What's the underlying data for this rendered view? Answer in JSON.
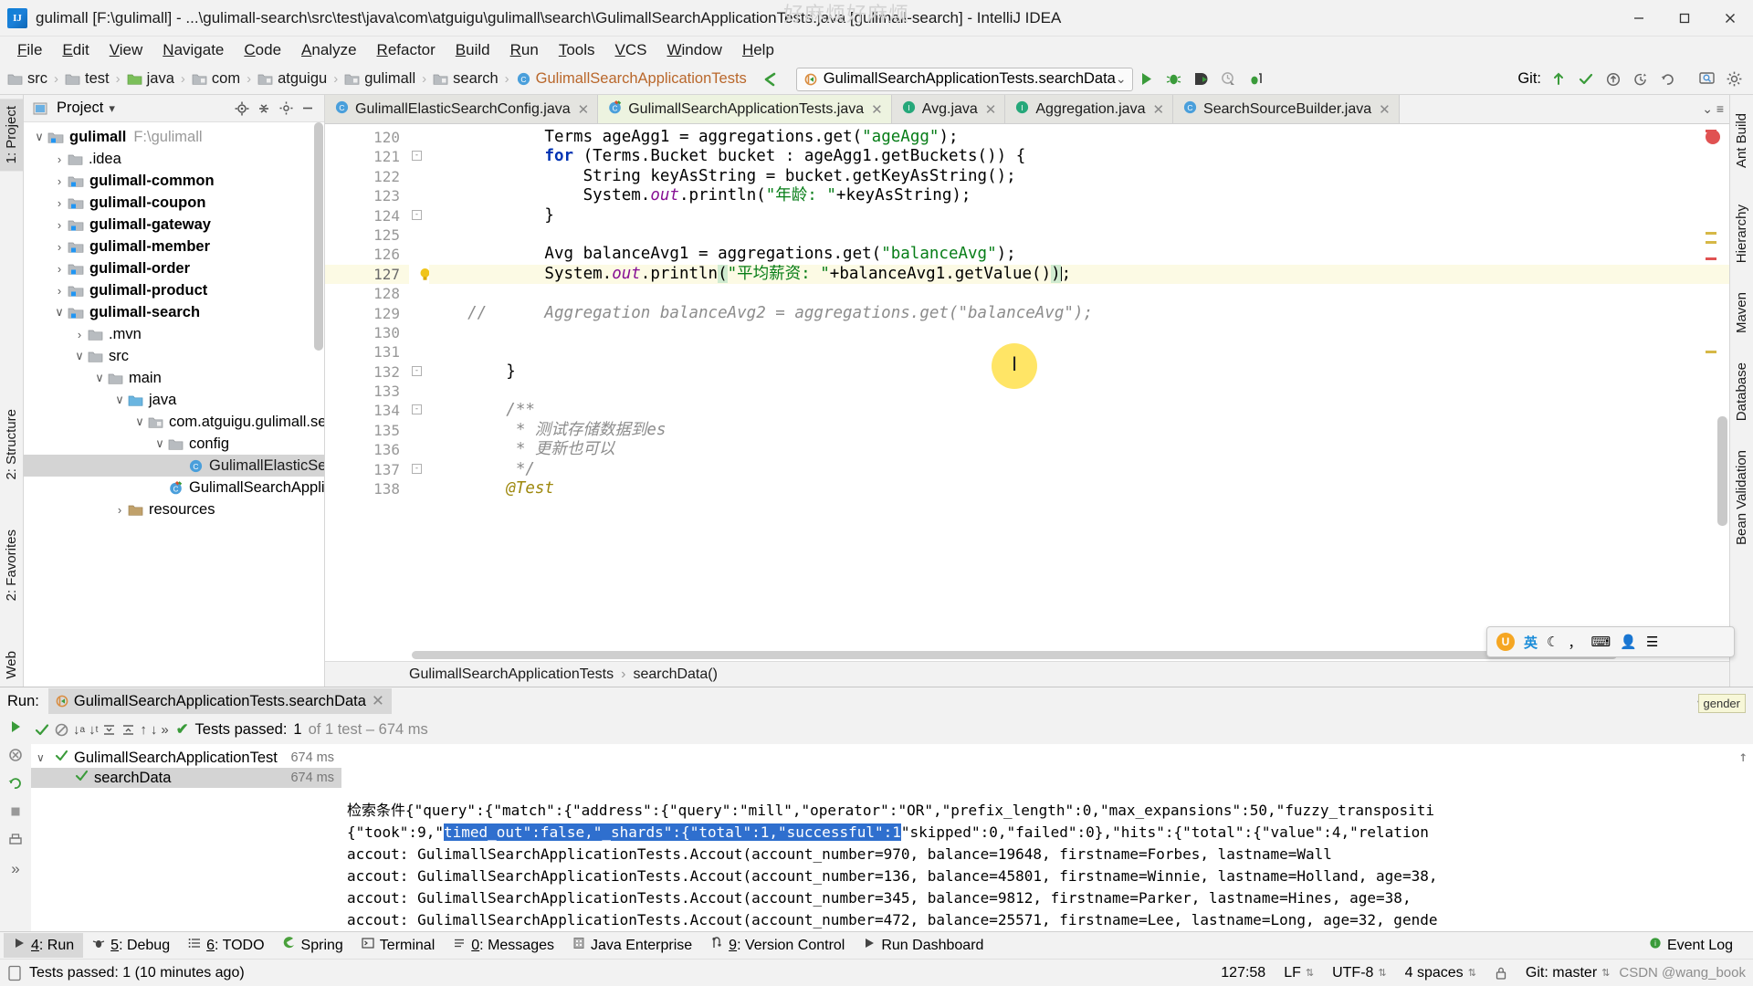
{
  "window": {
    "title": "gulimall [F:\\gulimall] - ...\\gulimall-search\\src\\test\\java\\com\\atguigu\\gulimall\\search\\GulimallSearchApplicationTests.java [gulimall-search] - IntelliJ IDEA",
    "app_icon": "IJ",
    "watermark_top": "好麻烦好麻烦",
    "minimize": "–",
    "maximize": "▢",
    "close": "✕"
  },
  "menu": [
    "File",
    "Edit",
    "View",
    "Navigate",
    "Code",
    "Analyze",
    "Refactor",
    "Build",
    "Run",
    "Tools",
    "VCS",
    "Window",
    "Help"
  ],
  "breadcrumb": [
    {
      "label": "src",
      "icon": "folder-icon"
    },
    {
      "label": "test",
      "icon": "folder-icon"
    },
    {
      "label": "java",
      "icon": "folder-green-icon"
    },
    {
      "label": "com",
      "icon": "package-icon"
    },
    {
      "label": "atguigu",
      "icon": "package-icon"
    },
    {
      "label": "gulimall",
      "icon": "package-icon"
    },
    {
      "label": "search",
      "icon": "package-icon"
    },
    {
      "label": "GulimallSearchApplicationTests",
      "icon": "class-icon"
    }
  ],
  "toolbar": {
    "run_config": "GulimallSearchApplicationTests.searchData",
    "dropdown_caret": "⌄",
    "buttons": [
      "run-button",
      "debug-button",
      "run-coverage-button",
      "profile-button",
      "stop-button"
    ],
    "git_label": "Git:",
    "git_buttons": [
      "update-project-icon",
      "commit-icon",
      "push-icon",
      "history-icon",
      "revert-icon"
    ],
    "right_buttons": [
      "search-everywhere-icon",
      "settings-icon"
    ]
  },
  "left_tool_tabs": [
    {
      "label": "1: Project",
      "selected": true
    }
  ],
  "right_tool_tabs": [
    "Ant Build",
    "Hierarchy",
    "Maven",
    "Database",
    "Bean Validation"
  ],
  "project_panel": {
    "title": "Project",
    "dropdown": "▾",
    "actions": [
      "locate-icon",
      "collapse-all-icon",
      "settings-icon",
      "hide-icon"
    ],
    "tree": [
      {
        "label": "gulimall",
        "path": "F:\\gulimall",
        "depth": 0,
        "arrow": "expanded",
        "icon": "module-icon",
        "bold": true
      },
      {
        "label": ".idea",
        "path": "",
        "depth": 1,
        "arrow": "collapsed",
        "icon": "folder-icon",
        "bold": false
      },
      {
        "label": "gulimall-common",
        "path": "",
        "depth": 1,
        "arrow": "collapsed",
        "icon": "module-icon",
        "bold": true
      },
      {
        "label": "gulimall-coupon",
        "path": "",
        "depth": 1,
        "arrow": "collapsed",
        "icon": "module-icon",
        "bold": true
      },
      {
        "label": "gulimall-gateway",
        "path": "",
        "depth": 1,
        "arrow": "collapsed",
        "icon": "module-icon",
        "bold": true
      },
      {
        "label": "gulimall-member",
        "path": "",
        "depth": 1,
        "arrow": "collapsed",
        "icon": "module-icon",
        "bold": true
      },
      {
        "label": "gulimall-order",
        "path": "",
        "depth": 1,
        "arrow": "collapsed",
        "icon": "module-icon",
        "bold": true
      },
      {
        "label": "gulimall-product",
        "path": "",
        "depth": 1,
        "arrow": "collapsed",
        "icon": "module-icon",
        "bold": true
      },
      {
        "label": "gulimall-search",
        "path": "",
        "depth": 1,
        "arrow": "expanded",
        "icon": "module-icon",
        "bold": true
      },
      {
        "label": ".mvn",
        "path": "",
        "depth": 2,
        "arrow": "collapsed",
        "icon": "folder-icon",
        "bold": false
      },
      {
        "label": "src",
        "path": "",
        "depth": 2,
        "arrow": "expanded",
        "icon": "folder-icon",
        "bold": false
      },
      {
        "label": "main",
        "path": "",
        "depth": 3,
        "arrow": "expanded",
        "icon": "folder-icon",
        "bold": false
      },
      {
        "label": "java",
        "path": "",
        "depth": 4,
        "arrow": "expanded",
        "icon": "folder-blue-icon",
        "bold": false
      },
      {
        "label": "com.atguigu.gulimall.sear",
        "path": "",
        "depth": 5,
        "arrow": "expanded",
        "icon": "package-icon",
        "bold": false
      },
      {
        "label": "config",
        "path": "",
        "depth": 6,
        "arrow": "expanded",
        "icon": "folder-icon",
        "bold": false
      },
      {
        "label": "GulimallElasticSear",
        "path": "",
        "depth": 7,
        "arrow": "none",
        "icon": "class-icon",
        "bold": false,
        "selected": true
      },
      {
        "label": "GulimallSearchApplica",
        "path": "",
        "depth": 6,
        "arrow": "none",
        "icon": "class-orange-icon",
        "bold": false
      },
      {
        "label": "resources",
        "path": "",
        "depth": 4,
        "arrow": "collapsed",
        "icon": "folder-resources-icon",
        "bold": false
      }
    ]
  },
  "editor_tabs": [
    {
      "label": "GulimallElasticSearchConfig.java",
      "icon": "class-icon",
      "active": false,
      "close": "✕"
    },
    {
      "label": "GulimallSearchApplicationTests.java",
      "icon": "test-class-icon",
      "active": true,
      "close": "✕"
    },
    {
      "label": "Avg.java",
      "icon": "interface-icon",
      "active": false,
      "close": "✕"
    },
    {
      "label": "Aggregation.java",
      "icon": "interface-icon",
      "active": false,
      "close": "✕"
    },
    {
      "label": "SearchSourceBuilder.java",
      "icon": "class-icon",
      "active": false,
      "close": "✕"
    }
  ],
  "editor": {
    "first_line": 120,
    "current_line": 127,
    "lines": [
      {
        "n": 120,
        "segments": [
          {
            "t": "            Terms ",
            "c": "typ"
          },
          {
            "t": "ageAgg1 ",
            "c": "typ"
          },
          {
            "t": "= aggregations.get(",
            "c": "typ"
          },
          {
            "t": "\"ageAgg\"",
            "c": "str"
          },
          {
            "t": ");",
            "c": "typ"
          }
        ]
      },
      {
        "n": 121,
        "fold": "-",
        "segments": [
          {
            "t": "            ",
            "c": "typ"
          },
          {
            "t": "for",
            "c": "kw"
          },
          {
            "t": " (Terms.Bucket bucket : ageAgg1.getBuckets()) {",
            "c": "typ"
          }
        ]
      },
      {
        "n": 122,
        "segments": [
          {
            "t": "                String keyAsString = bucket.getKeyAsString();",
            "c": "typ"
          }
        ]
      },
      {
        "n": 123,
        "segments": [
          {
            "t": "                System.",
            "c": "typ"
          },
          {
            "t": "out",
            "c": "fld"
          },
          {
            "t": ".println(",
            "c": "typ"
          },
          {
            "t": "\"年龄: \"",
            "c": "str"
          },
          {
            "t": "+keyAsString);",
            "c": "typ"
          }
        ]
      },
      {
        "n": 124,
        "fold": "-",
        "segments": [
          {
            "t": "            }",
            "c": "typ"
          }
        ]
      },
      {
        "n": 125,
        "segments": [
          {
            "t": "",
            "c": "typ"
          }
        ]
      },
      {
        "n": 126,
        "segments": [
          {
            "t": "            Avg balanceAvg1 = aggregations.get(",
            "c": "typ"
          },
          {
            "t": "\"balanceAvg\"",
            "c": "str"
          },
          {
            "t": ");",
            "c": "typ"
          }
        ]
      },
      {
        "n": 127,
        "current": true,
        "bulb": true,
        "segments": [
          {
            "t": "            System.",
            "c": "typ"
          },
          {
            "t": "out",
            "c": "fld"
          },
          {
            "t": ".println",
            "c": "typ"
          },
          {
            "t": "(",
            "c": "hl"
          },
          {
            "t": "\"平均薪资: \"",
            "c": "str"
          },
          {
            "t": "+balanceAvg1.getValue()",
            "c": "typ"
          },
          {
            "t": ")",
            "c": "hl"
          },
          {
            "t": ";",
            "c": "typ"
          }
        ]
      },
      {
        "n": 128,
        "segments": [
          {
            "t": "",
            "c": "typ"
          }
        ]
      },
      {
        "n": 129,
        "segments": [
          {
            "t": "    //      Aggregation balanceAvg2 = aggregations.get(\"balanceAvg\");",
            "c": "cmt"
          }
        ]
      },
      {
        "n": 130,
        "segments": [
          {
            "t": "",
            "c": "typ"
          }
        ]
      },
      {
        "n": 131,
        "segments": [
          {
            "t": "",
            "c": "typ"
          }
        ]
      },
      {
        "n": 132,
        "fold": "-",
        "segments": [
          {
            "t": "        }",
            "c": "typ"
          }
        ]
      },
      {
        "n": 133,
        "segments": [
          {
            "t": "",
            "c": "typ"
          }
        ]
      },
      {
        "n": 134,
        "fold": "-",
        "segments": [
          {
            "t": "        /**",
            "c": "cmt"
          }
        ]
      },
      {
        "n": 135,
        "segments": [
          {
            "t": "         * 测试存储数据到es",
            "c": "cmt"
          }
        ]
      },
      {
        "n": 136,
        "segments": [
          {
            "t": "         * 更新也可以",
            "c": "cmt"
          }
        ]
      },
      {
        "n": 137,
        "fold": "-",
        "segments": [
          {
            "t": "         */",
            "c": "cmt"
          }
        ]
      },
      {
        "n": 138,
        "segments": [
          {
            "t": "        @Test",
            "c": "ann"
          }
        ]
      }
    ],
    "bottom_breadcrumb": [
      "GulimallSearchApplicationTests",
      "searchData()"
    ]
  },
  "run_panel": {
    "label": "Run:",
    "tab_title": "GulimallSearchApplicationTests.searchData",
    "tab_close": "✕",
    "toolbar_icons": [
      "rerun-icon",
      "rerun-failed-icon",
      "sort-alpha-icon",
      "sort-duration-icon",
      "expand-all-icon",
      "collapse-all-icon",
      "prev-icon",
      "next-icon",
      "more-icon"
    ],
    "status": {
      "prefix": "Tests passed:",
      "count": "1",
      "detail": "of 1 test – 674 ms",
      "check": "✔"
    },
    "tree": [
      {
        "label": "GulimallSearchApplicationTest",
        "duration": "674 ms",
        "depth": 0,
        "icon": "passed-icon",
        "arrow": "expanded"
      },
      {
        "label": "searchData",
        "duration": "674 ms",
        "depth": 1,
        "icon": "passed-icon",
        "arrow": "none",
        "selected": true
      }
    ],
    "console_lines": [
      {
        "pre": "检索条件{\"query\":{\"match\":{\"address\":{\"query\":\"mill\",\"operator\":\"OR\",\"prefix_length\":0,\"max_expansions\":50,\"fuzzy_transpositi",
        "sel": "",
        "post": ""
      },
      {
        "pre": "{\"took\":9,\"",
        "sel": "timed_out\":false,\"_shards\":{\"total\":1,\"successful\":1",
        "post": "\"skipped\":0,\"failed\":0},\"hits\":{\"total\":{\"value\":4,\"relation"
      },
      {
        "pre": "accout: GulimallSearchApplicationTests.Accout(account_number=970, balance=19648, firstname=Forbes, lastname=Wall",
        "sel": "",
        "post": ""
      },
      {
        "pre": "accout: GulimallSearchApplicationTests.Accout(account_number=136, balance=45801, firstname=Winnie, lastname=Holland, age=38,",
        "sel": "",
        "post": ""
      },
      {
        "pre": "accout: GulimallSearchApplicationTests.Accout(account_number=345, balance=9812, firstname=Parker, lastname=Hines, age=38,",
        "sel": "",
        "post": ""
      },
      {
        "pre": "accout: GulimallSearchApplicationTests.Accout(account_number=472, balance=25571, firstname=Lee, lastname=Long, age=32, gende",
        "sel": "",
        "post": ""
      }
    ]
  },
  "bottom_tool_bar": [
    {
      "label": "4: Run",
      "icon": "run-icon",
      "selected": true
    },
    {
      "label": "5: Debug",
      "icon": "debug-icon",
      "selected": false
    },
    {
      "label": "6: TODO",
      "icon": "todo-icon",
      "selected": false
    },
    {
      "label": "Spring",
      "icon": "spring-icon",
      "selected": false
    },
    {
      "label": "Terminal",
      "icon": "terminal-icon",
      "selected": false
    },
    {
      "label": "0: Messages",
      "icon": "messages-icon",
      "selected": false
    },
    {
      "label": "Java Enterprise",
      "icon": "java-enterprise-icon",
      "selected": false
    },
    {
      "label": "9: Version Control",
      "icon": "version-control-icon",
      "selected": false
    },
    {
      "label": "Run Dashboard",
      "icon": "run-dashboard-icon",
      "selected": false
    }
  ],
  "event_log": {
    "label": "Event Log",
    "icon": "event-log-icon"
  },
  "statusbar": {
    "message": "Tests passed: 1 (10 minutes ago)",
    "caret": "127:58",
    "line_sep": "LF",
    "encoding": "UTF-8",
    "indent": "4 spaces",
    "branch": "Git: master",
    "lock_icon": "lock-icon",
    "watermark": "CSDN @wang_book"
  },
  "left_tool_strip_bottom": [
    {
      "label": "2: Structure"
    },
    {
      "label": "2: Favorites"
    },
    {
      "label": "Web"
    }
  ],
  "ime_popup": {
    "logo": "U",
    "mode": "英",
    "items": [
      "moon-icon",
      "comma-icon",
      "keyboard-icon",
      "person-icon",
      "menu-icon"
    ]
  },
  "tooltip": "gender",
  "colors": {
    "accent_green": "#3a9b3a",
    "selection_blue": "#2f6fce",
    "string_green": "#067d17",
    "keyword_blue": "#0033b3",
    "class_orange": "#b9672b",
    "current_line": "#fcfae4"
  }
}
